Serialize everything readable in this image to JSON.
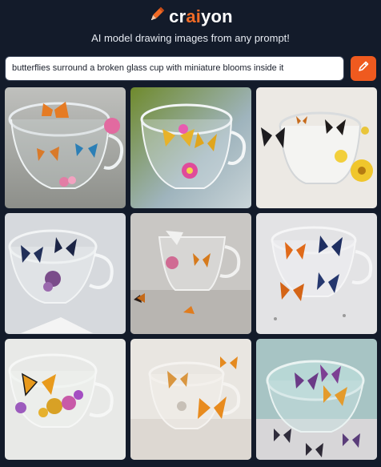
{
  "header": {
    "logo_part1": "cr",
    "logo_part2": "ai",
    "logo_part3": "yon",
    "tagline": "AI model drawing images from any prompt!"
  },
  "prompt": {
    "value": "butterflies surround a broken glass cup with miniature blooms inside it"
  },
  "draw_button": {
    "icon": "pencil-icon"
  },
  "colors": {
    "background": "#131b2a",
    "accent": "#ef5a1f",
    "input_bg": "#ffffff"
  },
  "gallery": {
    "images": [
      {
        "name": "generated-image-1",
        "scene": "glass cup with orange and blue butterflies, pink flowers"
      },
      {
        "name": "generated-image-2",
        "scene": "glass cup with yellow butterflies and magenta flowers on green background"
      },
      {
        "name": "generated-image-3",
        "scene": "glass cup with black butterflies and yellow flowers"
      },
      {
        "name": "generated-image-4",
        "scene": "tilted glass cup with blue butterflies and purple bloom"
      },
      {
        "name": "generated-image-5",
        "scene": "broken glass cup with orange butterflies on table"
      },
      {
        "name": "generated-image-6",
        "scene": "glass cup with orange and blue butterflies, shards"
      },
      {
        "name": "generated-image-7",
        "scene": "glass cup with monarch butterfly and purple flowers"
      },
      {
        "name": "generated-image-8",
        "scene": "glass cup with orange butterflies flying"
      },
      {
        "name": "generated-image-9",
        "scene": "teal glass cup with purple butterflies"
      }
    ]
  }
}
